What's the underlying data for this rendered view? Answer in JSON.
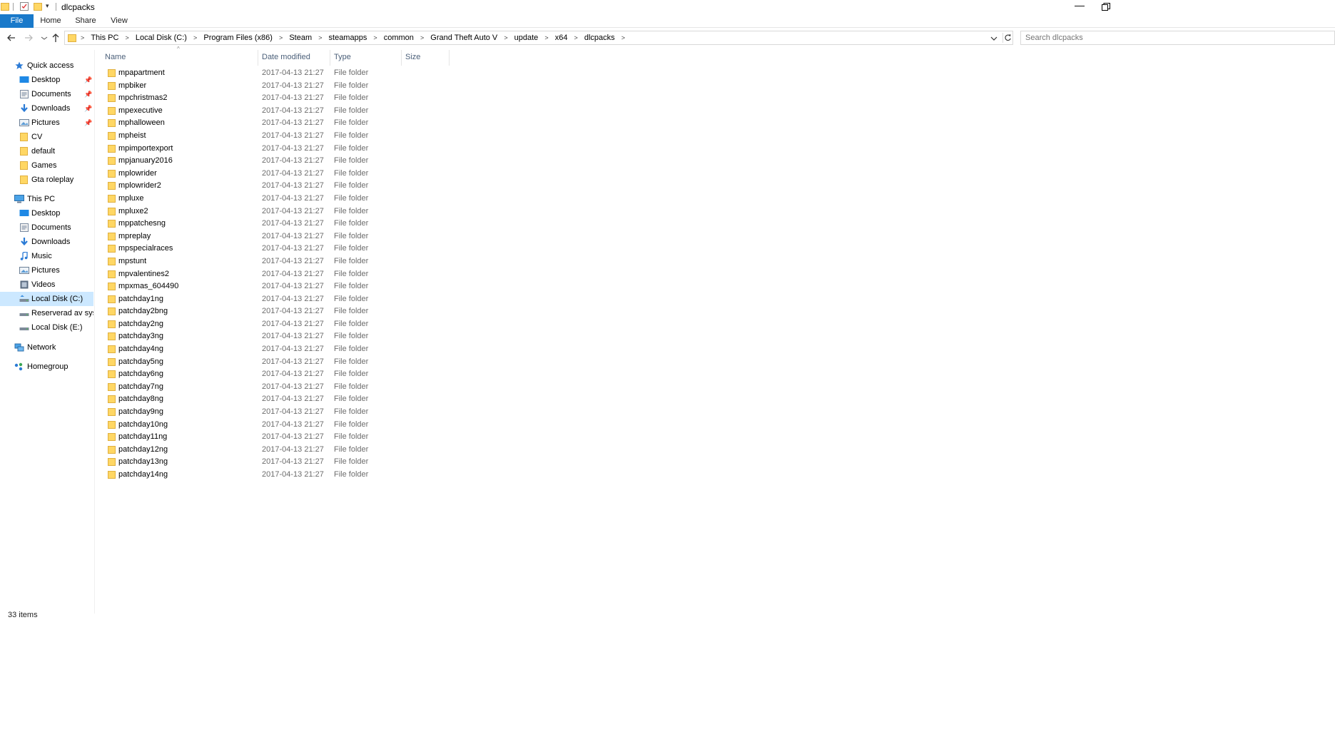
{
  "window": {
    "title": "dlcpacks",
    "minimize_glyph": "—"
  },
  "ribbon": {
    "tabs": [
      {
        "label": "File"
      },
      {
        "label": "Home"
      },
      {
        "label": "Share"
      },
      {
        "label": "View"
      }
    ]
  },
  "address": {
    "breadcrumbs": [
      "This PC",
      "Local Disk (C:)",
      "Program Files (x86)",
      "Steam",
      "steamapps",
      "common",
      "Grand Theft Auto V",
      "update",
      "x64",
      "dlcpacks"
    ],
    "separator": ">"
  },
  "search": {
    "placeholder": "Search dlcpacks"
  },
  "navpane": {
    "items": [
      {
        "label": "Quick access",
        "icon": "star-icon"
      },
      {
        "label": "Desktop",
        "icon": "desktop-icon",
        "pinned": true
      },
      {
        "label": "Documents",
        "icon": "documents-icon",
        "pinned": true
      },
      {
        "label": "Downloads",
        "icon": "downloads-icon",
        "pinned": true
      },
      {
        "label": "Pictures",
        "icon": "pictures-icon",
        "pinned": true
      },
      {
        "label": "CV",
        "icon": "folder-icon"
      },
      {
        "label": "default",
        "icon": "folder-icon"
      },
      {
        "label": "Games",
        "icon": "folder-icon"
      },
      {
        "label": "Gta roleplay",
        "icon": "folder-icon"
      },
      {
        "label": "This PC",
        "icon": "computer-icon"
      },
      {
        "label": "Desktop",
        "icon": "desktop-icon"
      },
      {
        "label": "Documents",
        "icon": "documents-icon"
      },
      {
        "label": "Downloads",
        "icon": "downloads-icon"
      },
      {
        "label": "Music",
        "icon": "music-icon"
      },
      {
        "label": "Pictures",
        "icon": "pictures-icon"
      },
      {
        "label": "Videos",
        "icon": "videos-icon"
      },
      {
        "label": "Local Disk (C:)",
        "icon": "drive-icon",
        "selected": true
      },
      {
        "label": "Reserverad av system",
        "icon": "drive-icon"
      },
      {
        "label": "Local Disk (E:)",
        "icon": "drive-icon"
      },
      {
        "label": "Network",
        "icon": "network-icon"
      },
      {
        "label": "Homegroup",
        "icon": "homegroup-icon"
      }
    ],
    "pin_glyph": "📌"
  },
  "columns": {
    "name": "Name",
    "date": "Date modified",
    "type": "Type",
    "size": "Size",
    "sort_glyph": "^"
  },
  "files": [
    {
      "name": "mpapartment",
      "date": "2017-04-13 21:27",
      "type": "File folder"
    },
    {
      "name": "mpbiker",
      "date": "2017-04-13 21:27",
      "type": "File folder"
    },
    {
      "name": "mpchristmas2",
      "date": "2017-04-13 21:27",
      "type": "File folder"
    },
    {
      "name": "mpexecutive",
      "date": "2017-04-13 21:27",
      "type": "File folder"
    },
    {
      "name": "mphalloween",
      "date": "2017-04-13 21:27",
      "type": "File folder"
    },
    {
      "name": "mpheist",
      "date": "2017-04-13 21:27",
      "type": "File folder"
    },
    {
      "name": "mpimportexport",
      "date": "2017-04-13 21:27",
      "type": "File folder"
    },
    {
      "name": "mpjanuary2016",
      "date": "2017-04-13 21:27",
      "type": "File folder"
    },
    {
      "name": "mplowrider",
      "date": "2017-04-13 21:27",
      "type": "File folder"
    },
    {
      "name": "mplowrider2",
      "date": "2017-04-13 21:27",
      "type": "File folder"
    },
    {
      "name": "mpluxe",
      "date": "2017-04-13 21:27",
      "type": "File folder"
    },
    {
      "name": "mpluxe2",
      "date": "2017-04-13 21:27",
      "type": "File folder"
    },
    {
      "name": "mppatchesng",
      "date": "2017-04-13 21:27",
      "type": "File folder"
    },
    {
      "name": "mpreplay",
      "date": "2017-04-13 21:27",
      "type": "File folder"
    },
    {
      "name": "mpspecialraces",
      "date": "2017-04-13 21:27",
      "type": "File folder"
    },
    {
      "name": "mpstunt",
      "date": "2017-04-13 21:27",
      "type": "File folder"
    },
    {
      "name": "mpvalentines2",
      "date": "2017-04-13 21:27",
      "type": "File folder"
    },
    {
      "name": "mpxmas_604490",
      "date": "2017-04-13 21:27",
      "type": "File folder"
    },
    {
      "name": "patchday1ng",
      "date": "2017-04-13 21:27",
      "type": "File folder"
    },
    {
      "name": "patchday2bng",
      "date": "2017-04-13 21:27",
      "type": "File folder"
    },
    {
      "name": "patchday2ng",
      "date": "2017-04-13 21:27",
      "type": "File folder"
    },
    {
      "name": "patchday3ng",
      "date": "2017-04-13 21:27",
      "type": "File folder"
    },
    {
      "name": "patchday4ng",
      "date": "2017-04-13 21:27",
      "type": "File folder"
    },
    {
      "name": "patchday5ng",
      "date": "2017-04-13 21:27",
      "type": "File folder"
    },
    {
      "name": "patchday6ng",
      "date": "2017-04-13 21:27",
      "type": "File folder"
    },
    {
      "name": "patchday7ng",
      "date": "2017-04-13 21:27",
      "type": "File folder"
    },
    {
      "name": "patchday8ng",
      "date": "2017-04-13 21:27",
      "type": "File folder"
    },
    {
      "name": "patchday9ng",
      "date": "2017-04-13 21:27",
      "type": "File folder"
    },
    {
      "name": "patchday10ng",
      "date": "2017-04-13 21:27",
      "type": "File folder"
    },
    {
      "name": "patchday11ng",
      "date": "2017-04-13 21:27",
      "type": "File folder"
    },
    {
      "name": "patchday12ng",
      "date": "2017-04-13 21:27",
      "type": "File folder"
    },
    {
      "name": "patchday13ng",
      "date": "2017-04-13 21:27",
      "type": "File folder"
    },
    {
      "name": "patchday14ng",
      "date": "2017-04-13 21:27",
      "type": "File folder"
    }
  ],
  "status": {
    "item_count": "33 items"
  },
  "colors": {
    "accent": "#1979ca",
    "selection": "#cce8ff",
    "folder": "#ffd764",
    "header_text": "#4c607a",
    "secondary_text": "#6d6d6d"
  }
}
